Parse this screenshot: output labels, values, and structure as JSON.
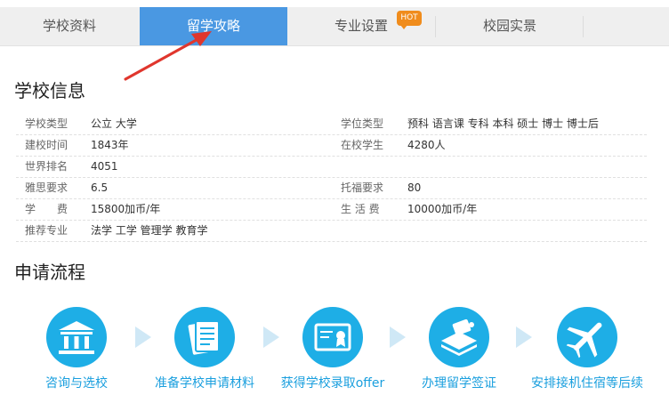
{
  "tabs": [
    {
      "label": "学校资料"
    },
    {
      "label": "留学攻略"
    },
    {
      "label": "专业设置"
    },
    {
      "label": "校园实景"
    }
  ],
  "hot_badge": "HOT",
  "school_info": {
    "title": "学校信息",
    "rows": [
      {
        "label": "学校类型",
        "value": "公立 大学",
        "label2": "学位类型",
        "value2": "预科 语言课 专科 本科 硕士 博士 博士后"
      },
      {
        "label": "建校时间",
        "value": "1843年",
        "label2": "在校学生",
        "value2": "4280人"
      },
      {
        "label": "世界排名",
        "value": "4051",
        "label2": "",
        "value2": ""
      },
      {
        "label": "雅思要求",
        "value": "6.5",
        "label2": "托福要求",
        "value2": "80"
      },
      {
        "label": "学　　费",
        "value": "15800加币/年",
        "label2": "生 活 费",
        "value2": "10000加币/年"
      },
      {
        "label": "推荐专业",
        "value": "法学 工学 管理学 教育学",
        "label2": "",
        "value2": ""
      }
    ]
  },
  "process": {
    "title": "申请流程",
    "steps": [
      {
        "label": "咨询与选校",
        "icon": "building-icon"
      },
      {
        "label": "准备学校申请材料",
        "icon": "document-icon"
      },
      {
        "label": "获得学校录取offer",
        "icon": "certificate-icon"
      },
      {
        "label": "办理留学签证",
        "icon": "passport-icon"
      },
      {
        "label": "安排接机住宿等后续",
        "icon": "airplane-icon"
      }
    ]
  },
  "colors": {
    "accent": "#4a98e2",
    "step_blue": "#1eaee6",
    "hot": "#f08c1c",
    "arrow": "#e0362d"
  }
}
